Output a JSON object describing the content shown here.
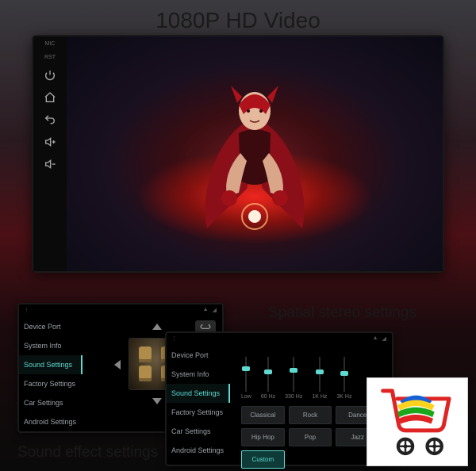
{
  "title": "1080P HD Video",
  "captions": {
    "spatial": "Spatial stereo settings",
    "sound_effect": "Sound effect settings"
  },
  "main_sidebar": {
    "mic": "MIC",
    "rst": "RST"
  },
  "settings_menu": [
    "Device Port",
    "System Info",
    "Sound Settings",
    "Factory Settings",
    "Car Settings",
    "Android Settings"
  ],
  "settings_active_index": 2,
  "eq": {
    "bands": [
      {
        "label": "Low",
        "value": 60
      },
      {
        "label": "60 Hz",
        "value": 50
      },
      {
        "label": "330 Hz",
        "value": 55
      },
      {
        "label": "1K Hz",
        "value": 50
      },
      {
        "label": "3K Hz",
        "value": 45
      }
    ]
  },
  "presets": {
    "items": [
      "Classical",
      "Rock",
      "Dance",
      "Hip Hop",
      "Pop",
      "Jazz",
      "Custom"
    ],
    "active_index": 6
  },
  "logo_colors": {
    "blue": "#1560d4",
    "green": "#1aa81a",
    "yellow": "#ffd21e",
    "red": "#e02424"
  }
}
